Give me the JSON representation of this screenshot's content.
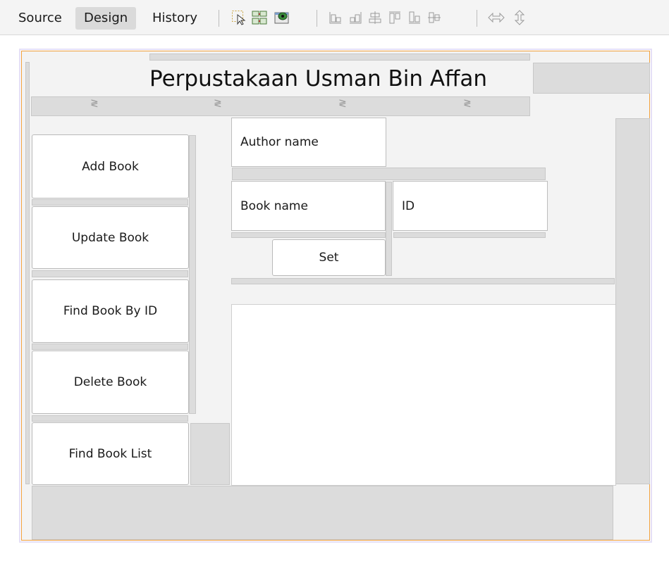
{
  "toolbar": {
    "tabs": [
      {
        "label": "Source",
        "active": false
      },
      {
        "label": "Design",
        "active": true
      },
      {
        "label": "History",
        "active": false
      }
    ]
  },
  "form": {
    "title": "Perpustakaan Usman Bin Affan",
    "buttons": {
      "add": "Add Book",
      "update": "Update Book",
      "find_by_id": "Find Book By ID",
      "delete": "Delete Book",
      "find_list": "Find Book List",
      "set": "Set"
    },
    "fields": {
      "author": "Author name",
      "book": "Book name",
      "id": "ID"
    }
  },
  "colors": {
    "selection_border": "#f0a03c",
    "canvas": "#f3f3f3",
    "gap_filler": "#dcdcdc"
  }
}
